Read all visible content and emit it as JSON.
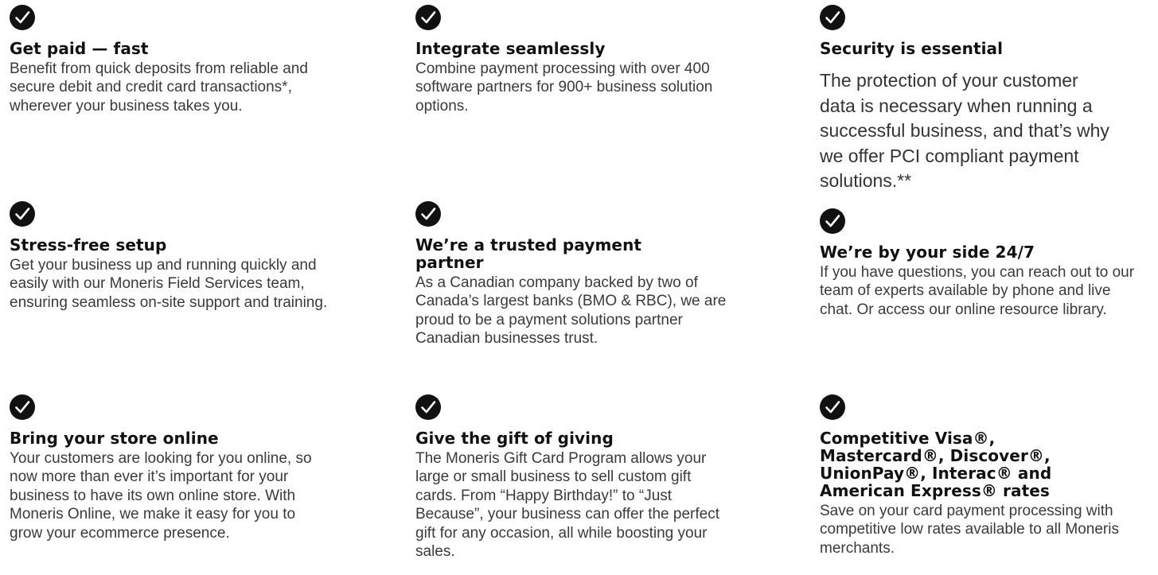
{
  "colors": {
    "check_fill": "#111111",
    "check_mark": "#ffffff",
    "title": "#111111",
    "text": "#3a3a3a"
  },
  "features": [
    {
      "icon": "checkmark-circle-icon",
      "title": "Get paid — fast",
      "description": "Benefit from quick deposits from reliable and secure debit and credit card transactions*, wherever your business takes you."
    },
    {
      "icon": "checkmark-circle-icon",
      "title": "Integrate seamlessly",
      "description": "Combine payment processing with over 400 software partners for 900+ business solution options."
    },
    {
      "icon": "checkmark-circle-icon",
      "title": "Security is essential",
      "description": "The protection of your customer data is necessary when running a successful business, and that’s why we offer PCI compliant payment solutions.**"
    },
    {
      "icon": "checkmark-circle-icon",
      "title": "Stress-free setup",
      "description": "Get your business up and running quickly and easily with our Moneris Field Services team, ensuring seamless on-site support and training."
    },
    {
      "icon": "checkmark-circle-icon",
      "title": "We’re a trusted payment partner",
      "description": "As a Canadian company backed by two of Canada’s largest banks (BMO & RBC), we are proud to be a payment solutions partner Canadian businesses trust."
    },
    {
      "icon": "checkmark-circle-icon",
      "title": "We’re by your side 24/7",
      "description": "If you have questions, you can reach out to our team of experts available by phone and live chat. Or access our online resource library."
    },
    {
      "icon": "checkmark-circle-icon",
      "title": "Bring your store online",
      "description": "Your customers are looking for you online, so now more than ever it’s important for your business to have its own online store. With Moneris Online, we make it easy for you to grow your ecommerce presence."
    },
    {
      "icon": "checkmark-circle-icon",
      "title": "Give the gift of giving",
      "description": "The Moneris Gift Card Program allows your large or small business to sell custom gift cards. From “Happy Birthday!” to “Just Because”, your business can offer the perfect gift for any occasion, all while boosting your sales."
    },
    {
      "icon": "checkmark-circle-icon",
      "title": "Competitive Visa®, Mastercard®, Discover®, UnionPay®, Interac® and American Express® rates",
      "description": "Save on your card payment processing with competitive low rates available to all Moneris merchants."
    }
  ]
}
